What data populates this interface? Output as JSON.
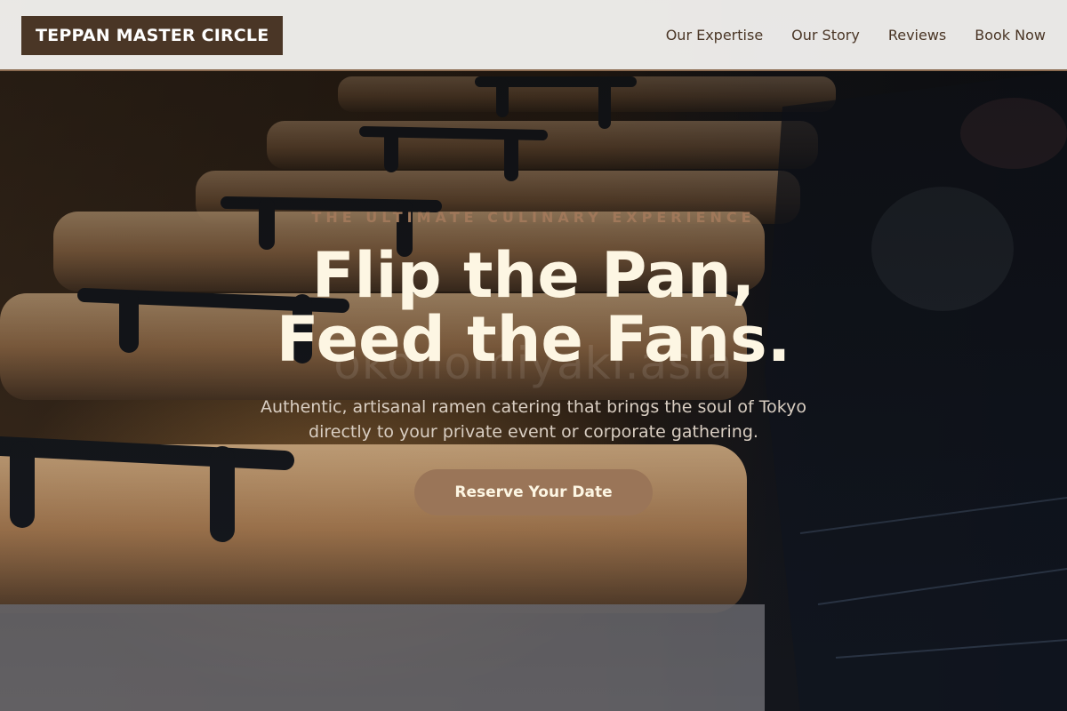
{
  "header": {
    "brand": "TEPPAN MASTER CIRCLE",
    "nav": [
      {
        "label": "Our Expertise"
      },
      {
        "label": "Our Story"
      },
      {
        "label": "Reviews"
      },
      {
        "label": "Book Now"
      }
    ]
  },
  "hero": {
    "eyebrow": "THE ULTIMATE CULINARY EXPERIENCE",
    "headline_line1": "Flip the Pan,",
    "headline_line2": "Feed the Fans.",
    "subtext_line1": "Authentic, artisanal ramen catering that brings the soul of Tokyo",
    "subtext_line2": "directly to your private event or corporate gathering.",
    "cta_label": "Reserve Your Date",
    "watermark": "okonomiyaki.asia"
  },
  "colors": {
    "brand_bg": "#4a3626",
    "accent": "#9a7558",
    "eyebrow": "#a0785a",
    "headline": "#fdf6e3",
    "header_bg": "#f4f3f1"
  }
}
